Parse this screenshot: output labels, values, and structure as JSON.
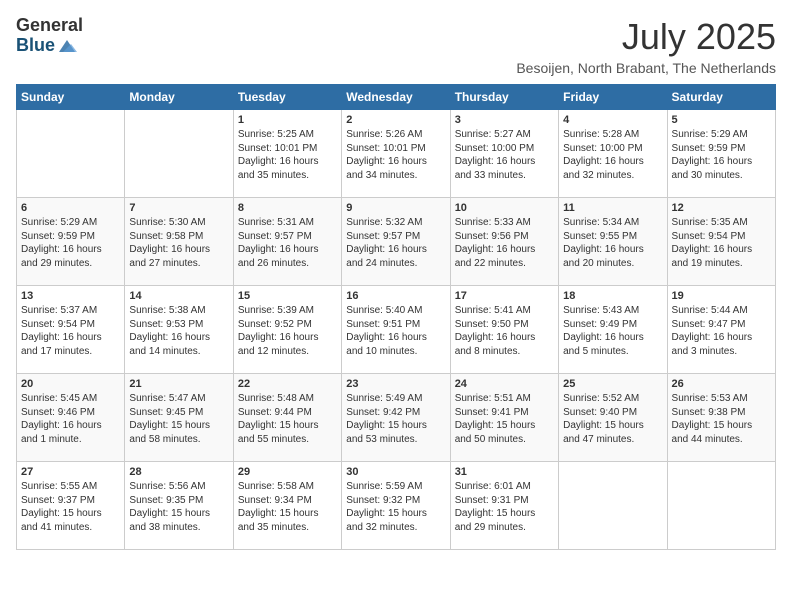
{
  "header": {
    "logo_line1": "General",
    "logo_line2": "Blue",
    "month": "July 2025",
    "location": "Besoijen, North Brabant, The Netherlands"
  },
  "days_of_week": [
    "Sunday",
    "Monday",
    "Tuesday",
    "Wednesday",
    "Thursday",
    "Friday",
    "Saturday"
  ],
  "weeks": [
    [
      {
        "day": "",
        "content": ""
      },
      {
        "day": "",
        "content": ""
      },
      {
        "day": "1",
        "content": "Sunrise: 5:25 AM\nSunset: 10:01 PM\nDaylight: 16 hours\nand 35 minutes."
      },
      {
        "day": "2",
        "content": "Sunrise: 5:26 AM\nSunset: 10:01 PM\nDaylight: 16 hours\nand 34 minutes."
      },
      {
        "day": "3",
        "content": "Sunrise: 5:27 AM\nSunset: 10:00 PM\nDaylight: 16 hours\nand 33 minutes."
      },
      {
        "day": "4",
        "content": "Sunrise: 5:28 AM\nSunset: 10:00 PM\nDaylight: 16 hours\nand 32 minutes."
      },
      {
        "day": "5",
        "content": "Sunrise: 5:29 AM\nSunset: 9:59 PM\nDaylight: 16 hours\nand 30 minutes."
      }
    ],
    [
      {
        "day": "6",
        "content": "Sunrise: 5:29 AM\nSunset: 9:59 PM\nDaylight: 16 hours\nand 29 minutes."
      },
      {
        "day": "7",
        "content": "Sunrise: 5:30 AM\nSunset: 9:58 PM\nDaylight: 16 hours\nand 27 minutes."
      },
      {
        "day": "8",
        "content": "Sunrise: 5:31 AM\nSunset: 9:57 PM\nDaylight: 16 hours\nand 26 minutes."
      },
      {
        "day": "9",
        "content": "Sunrise: 5:32 AM\nSunset: 9:57 PM\nDaylight: 16 hours\nand 24 minutes."
      },
      {
        "day": "10",
        "content": "Sunrise: 5:33 AM\nSunset: 9:56 PM\nDaylight: 16 hours\nand 22 minutes."
      },
      {
        "day": "11",
        "content": "Sunrise: 5:34 AM\nSunset: 9:55 PM\nDaylight: 16 hours\nand 20 minutes."
      },
      {
        "day": "12",
        "content": "Sunrise: 5:35 AM\nSunset: 9:54 PM\nDaylight: 16 hours\nand 19 minutes."
      }
    ],
    [
      {
        "day": "13",
        "content": "Sunrise: 5:37 AM\nSunset: 9:54 PM\nDaylight: 16 hours\nand 17 minutes."
      },
      {
        "day": "14",
        "content": "Sunrise: 5:38 AM\nSunset: 9:53 PM\nDaylight: 16 hours\nand 14 minutes."
      },
      {
        "day": "15",
        "content": "Sunrise: 5:39 AM\nSunset: 9:52 PM\nDaylight: 16 hours\nand 12 minutes."
      },
      {
        "day": "16",
        "content": "Sunrise: 5:40 AM\nSunset: 9:51 PM\nDaylight: 16 hours\nand 10 minutes."
      },
      {
        "day": "17",
        "content": "Sunrise: 5:41 AM\nSunset: 9:50 PM\nDaylight: 16 hours\nand 8 minutes."
      },
      {
        "day": "18",
        "content": "Sunrise: 5:43 AM\nSunset: 9:49 PM\nDaylight: 16 hours\nand 5 minutes."
      },
      {
        "day": "19",
        "content": "Sunrise: 5:44 AM\nSunset: 9:47 PM\nDaylight: 16 hours\nand 3 minutes."
      }
    ],
    [
      {
        "day": "20",
        "content": "Sunrise: 5:45 AM\nSunset: 9:46 PM\nDaylight: 16 hours\nand 1 minute."
      },
      {
        "day": "21",
        "content": "Sunrise: 5:47 AM\nSunset: 9:45 PM\nDaylight: 15 hours\nand 58 minutes."
      },
      {
        "day": "22",
        "content": "Sunrise: 5:48 AM\nSunset: 9:44 PM\nDaylight: 15 hours\nand 55 minutes."
      },
      {
        "day": "23",
        "content": "Sunrise: 5:49 AM\nSunset: 9:42 PM\nDaylight: 15 hours\nand 53 minutes."
      },
      {
        "day": "24",
        "content": "Sunrise: 5:51 AM\nSunset: 9:41 PM\nDaylight: 15 hours\nand 50 minutes."
      },
      {
        "day": "25",
        "content": "Sunrise: 5:52 AM\nSunset: 9:40 PM\nDaylight: 15 hours\nand 47 minutes."
      },
      {
        "day": "26",
        "content": "Sunrise: 5:53 AM\nSunset: 9:38 PM\nDaylight: 15 hours\nand 44 minutes."
      }
    ],
    [
      {
        "day": "27",
        "content": "Sunrise: 5:55 AM\nSunset: 9:37 PM\nDaylight: 15 hours\nand 41 minutes."
      },
      {
        "day": "28",
        "content": "Sunrise: 5:56 AM\nSunset: 9:35 PM\nDaylight: 15 hours\nand 38 minutes."
      },
      {
        "day": "29",
        "content": "Sunrise: 5:58 AM\nSunset: 9:34 PM\nDaylight: 15 hours\nand 35 minutes."
      },
      {
        "day": "30",
        "content": "Sunrise: 5:59 AM\nSunset: 9:32 PM\nDaylight: 15 hours\nand 32 minutes."
      },
      {
        "day": "31",
        "content": "Sunrise: 6:01 AM\nSunset: 9:31 PM\nDaylight: 15 hours\nand 29 minutes."
      },
      {
        "day": "",
        "content": ""
      },
      {
        "day": "",
        "content": ""
      }
    ]
  ]
}
